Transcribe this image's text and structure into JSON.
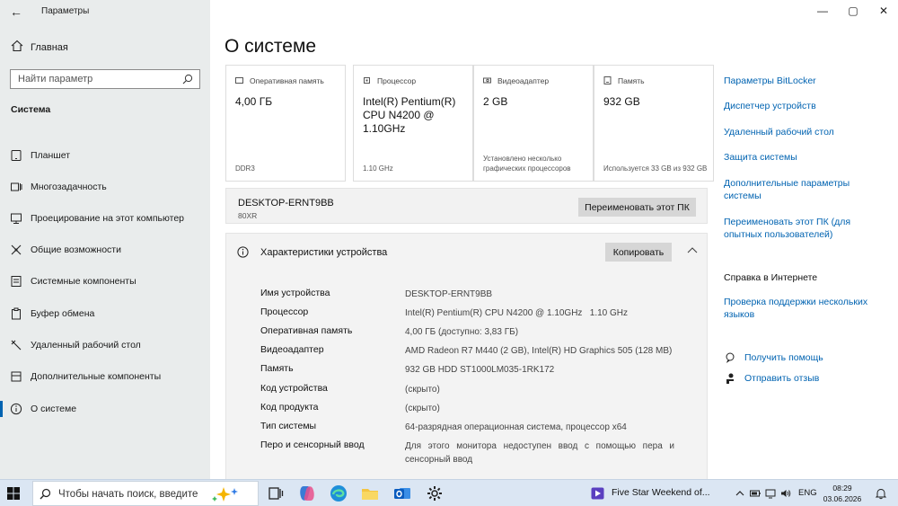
{
  "window": {
    "app_title": "Параметры",
    "back_glyph": "←",
    "minimize_glyph": "—",
    "maximize_glyph": "▢",
    "close_glyph": "✕"
  },
  "sidebar": {
    "home_label": "Главная",
    "search_placeholder": "Найти параметр",
    "section_label": "Система",
    "items": [
      {
        "label": "Планшет",
        "icon": "tablet-icon"
      },
      {
        "label": "Многозадачность",
        "icon": "multitasking-icon"
      },
      {
        "label": "Проецирование на этот компьютер",
        "icon": "projection-icon"
      },
      {
        "label": "Общие возможности",
        "icon": "shared-experiences-icon"
      },
      {
        "label": "Системные компоненты",
        "icon": "system-components-icon"
      },
      {
        "label": "Буфер обмена",
        "icon": "clipboard-icon"
      },
      {
        "label": "Удаленный рабочий стол",
        "icon": "remote-desktop-icon"
      },
      {
        "label": "Дополнительные компоненты",
        "icon": "optional-features-icon"
      },
      {
        "label": "О системе",
        "icon": "info-icon",
        "active": true
      }
    ]
  },
  "main": {
    "title": "О системе",
    "cards": [
      {
        "header": "Оперативная память",
        "value": "4,00 ГБ",
        "footer": "DDR3",
        "icon": "ram-icon"
      },
      {
        "header": "Процессор",
        "value": "Intel(R) Pentium(R) CPU N4200 @ 1.10GHz",
        "footer": "1.10 GHz",
        "icon": "cpu-icon"
      },
      {
        "header": "Видеоадаптер",
        "value": "2 GB",
        "footer": "Установлено несколько графических процессоров",
        "icon": "gpu-icon"
      },
      {
        "header": "Память",
        "value": "932 GB",
        "footer": "Используется 33 GB из 932 GB",
        "icon": "storage-icon"
      }
    ],
    "pc": {
      "name": "DESKTOP-ERNT9BB",
      "model": "80XR",
      "rename_label": "Переименовать этот ПК"
    },
    "specs": {
      "title": "Характеристики устройства",
      "copy_label": "Копировать",
      "rows": [
        {
          "key": "Имя устройства",
          "value": "DESKTOP-ERNT9BB"
        },
        {
          "key": "Процессор",
          "value": "Intel(R) Pentium(R) CPU N4200 @ 1.10GHz   1.10 GHz"
        },
        {
          "key": "Оперативная память",
          "value": "4,00 ГБ (доступно: 3,83 ГБ)"
        },
        {
          "key": "Видеоадаптер",
          "value": "AMD Radeon R7 M440 (2 GB), Intel(R) HD Graphics 505 (128 MB)"
        },
        {
          "key": "Память",
          "value": "932 GB HDD ST1000LM035-1RK172"
        },
        {
          "key": "Код устройства",
          "value": "(скрыто)"
        },
        {
          "key": "Код продукта",
          "value": "(скрыто)"
        },
        {
          "key": "Тип системы",
          "value": "64-разрядная операционная система, процессор x64"
        },
        {
          "key": "Перо и сенсорный ввод",
          "value": "Для этого монитора недоступен ввод с помощью пера и сенсорный ввод"
        }
      ]
    }
  },
  "related_links": {
    "items": [
      "Параметры BitLocker",
      "Диспетчер устройств",
      "Удаленный рабочий стол",
      "Защита системы",
      "Дополнительные параметры системы",
      "Переименовать этот ПК (для опытных пользователей)"
    ],
    "web_help_header": "Справка в Интернете",
    "web_help_link": "Проверка поддержки нескольких языков",
    "get_help": "Получить помощь",
    "feedback": "Отправить отзыв"
  },
  "taskbar": {
    "search_placeholder": "Чтобы начать поиск, введите",
    "media_title": "Five Star Weekend of...",
    "language": "ENG",
    "time": "08:29",
    "date": "03.06.2026",
    "accent": "#0063b1"
  }
}
